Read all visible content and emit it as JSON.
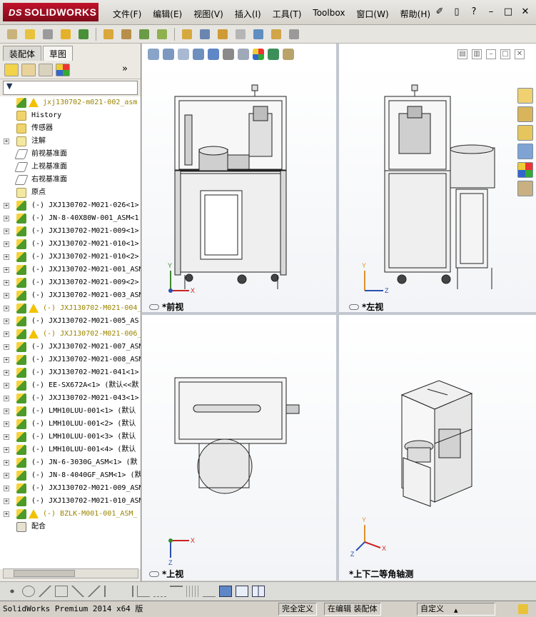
{
  "app": {
    "logo": "SOLIDWORKS",
    "logo_prefix": "DS"
  },
  "menu": [
    "文件(F)",
    "编辑(E)",
    "视图(V)",
    "插入(I)",
    "工具(T)",
    "Toolbox",
    "窗口(W)",
    "帮助(H)"
  ],
  "window_controls": [
    "new-doc-icon",
    "help-icon",
    "minimize-icon",
    "restore-icon",
    "close-icon"
  ],
  "left_panel": {
    "tabs": [
      "装配体",
      "草图"
    ],
    "active_tab": "装配体",
    "filter_icon": "filter-icon",
    "tree": [
      {
        "label": "jxj130702-m021-002_asm",
        "type": "asm",
        "warning": true,
        "expander": false
      },
      {
        "label": "History",
        "type": "folder",
        "warning": false,
        "expander": false
      },
      {
        "label": "传感器",
        "type": "folder",
        "warning": false,
        "expander": false
      },
      {
        "label": "注解",
        "type": "note",
        "warning": false,
        "expander": true
      },
      {
        "label": "前视基准面",
        "type": "plane",
        "warning": false,
        "expander": false
      },
      {
        "label": "上视基准面",
        "type": "plane",
        "warning": false,
        "expander": false
      },
      {
        "label": "右视基准面",
        "type": "plane",
        "warning": false,
        "expander": false
      },
      {
        "label": "原点",
        "type": "origin",
        "warning": false,
        "expander": false
      },
      {
        "label": "(-) JXJ130702-M021-026<1>",
        "type": "asm",
        "warning": false,
        "expander": true
      },
      {
        "label": "(-) JN-8-40X80W-001_ASM<1",
        "type": "asm",
        "warning": false,
        "expander": true
      },
      {
        "label": "(-) JXJ130702-M021-009<1>",
        "type": "asm",
        "warning": false,
        "expander": true
      },
      {
        "label": "(-) JXJ130702-M021-010<1>",
        "type": "asm",
        "warning": false,
        "expander": true
      },
      {
        "label": "(-) JXJ130702-M021-010<2>",
        "type": "asm",
        "warning": false,
        "expander": true
      },
      {
        "label": "(-) JXJ130702-M021-001_ASM",
        "type": "asm",
        "warning": false,
        "expander": true
      },
      {
        "label": "(-) JXJ130702-M021-009<2>",
        "type": "asm",
        "warning": false,
        "expander": true
      },
      {
        "label": "(-) JXJ130702-M021-003_ASM",
        "type": "asm",
        "warning": false,
        "expander": true
      },
      {
        "label": "(-) JXJ130702-M021-004_",
        "type": "asm",
        "warning": true,
        "expander": true
      },
      {
        "label": "(-) JXJ130702-M021-005_AS",
        "type": "asm",
        "warning": false,
        "expander": true
      },
      {
        "label": "(-) JXJ130702-M021-006_",
        "type": "asm",
        "warning": true,
        "expander": true
      },
      {
        "label": "(-) JXJ130702-M021-007_ASM",
        "type": "asm",
        "warning": false,
        "expander": true
      },
      {
        "label": "(-) JXJ130702-M021-008_ASM",
        "type": "asm",
        "warning": false,
        "expander": true
      },
      {
        "label": "(-) JXJ130702-M021-041<1>",
        "type": "asm",
        "warning": false,
        "expander": true
      },
      {
        "label": "(-) EE-SX672A<1> (默认<<默",
        "type": "asm",
        "warning": false,
        "expander": true
      },
      {
        "label": "(-) JXJ130702-M021-043<1>",
        "type": "asm",
        "warning": false,
        "expander": true
      },
      {
        "label": "(-) LMH10LUU-001<1> (默认",
        "type": "asm",
        "warning": false,
        "expander": true
      },
      {
        "label": "(-) LMH10LUU-001<2> (默认",
        "type": "asm",
        "warning": false,
        "expander": true
      },
      {
        "label": "(-) LMH10LUU-001<3> (默认",
        "type": "asm",
        "warning": false,
        "expander": true
      },
      {
        "label": "(-) LMH10LUU-001<4> (默认",
        "type": "asm",
        "warning": false,
        "expander": true
      },
      {
        "label": "(-) JN-6-3030G_ASM<1> (默",
        "type": "asm",
        "warning": false,
        "expander": true
      },
      {
        "label": "(-) JN-8-4040GF_ASM<1> (默",
        "type": "asm",
        "warning": false,
        "expander": true
      },
      {
        "label": "(-) JXJ130702-M021-009_ASM",
        "type": "asm",
        "warning": false,
        "expander": true
      },
      {
        "label": "(-) JXJ130702-M021-010_ASM",
        "type": "asm",
        "warning": false,
        "expander": true
      },
      {
        "label": "(-) BZLK-M001-001_ASM_",
        "type": "asm",
        "warning": true,
        "expander": true
      },
      {
        "label": "配合",
        "type": "mate",
        "warning": false,
        "expander": false
      }
    ]
  },
  "viewports": {
    "front": "*前视",
    "left": "*左视",
    "top": "*上视",
    "iso": "*上下二等角轴测"
  },
  "axis_labels": {
    "x": "X",
    "y": "Y",
    "z": "Z"
  },
  "status": {
    "product": "SolidWorks Premium 2014 x64 版",
    "fully_defined": "完全定义",
    "editing": "在编辑 装配体",
    "custom": "自定义"
  }
}
